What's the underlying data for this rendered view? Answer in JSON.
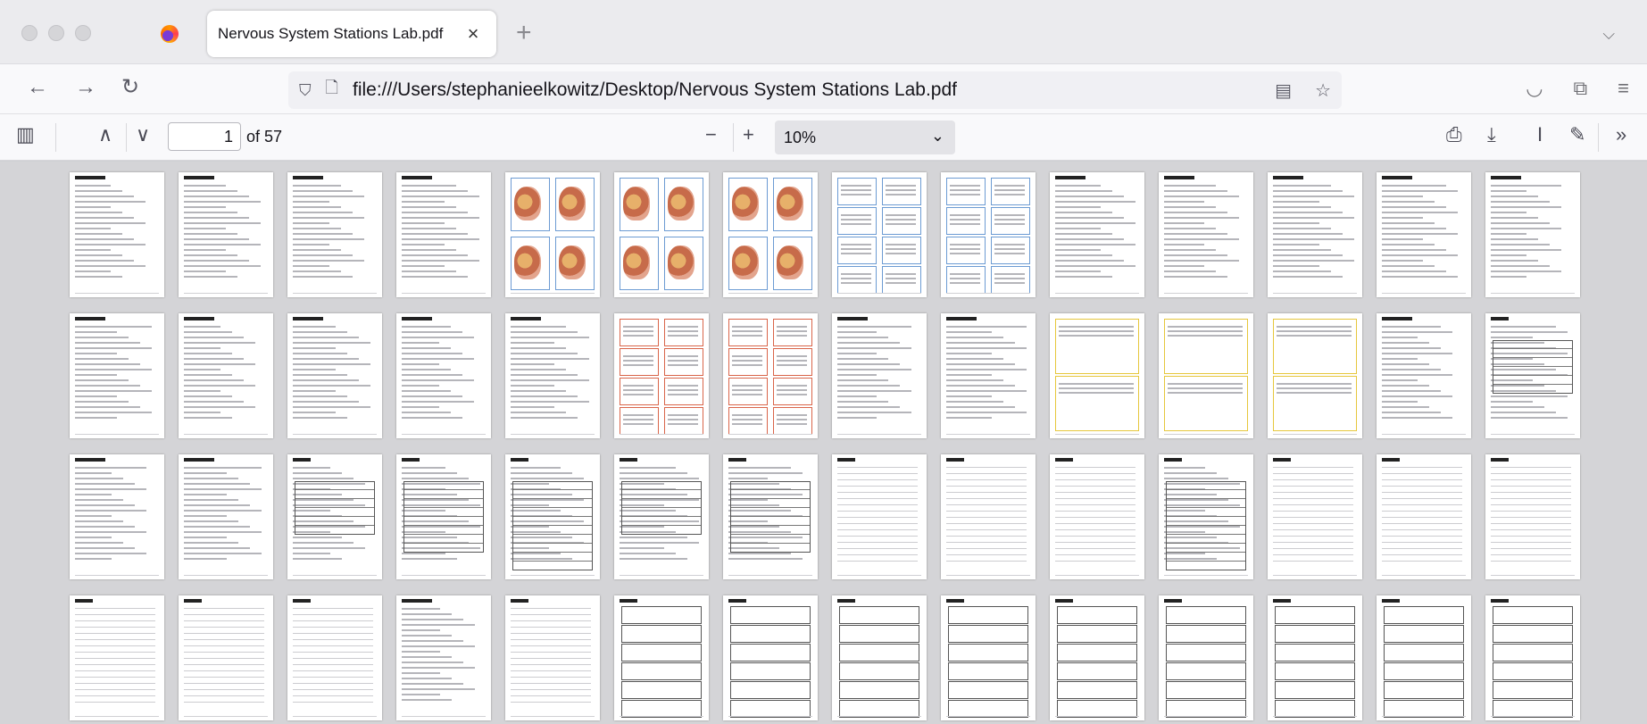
{
  "browser": {
    "tab_title": "Nervous System Stations Lab.pdf",
    "url": "file:///Users/stephanieelkowitz/Desktop/Nervous System Stations Lab.pdf"
  },
  "pdf": {
    "current_page": "1",
    "page_count_label": "of 57",
    "zoom": "10%",
    "thumbnail_count": 57
  },
  "icons": {
    "close": "×",
    "new_tab": "+",
    "tab_list": "⌵",
    "back": "←",
    "forward": "→",
    "reload": "↻",
    "shield": "⛉",
    "page": "🗋",
    "reader": "▤",
    "star": "☆",
    "pocket": "◡",
    "extensions": "⧉",
    "menu": "≡",
    "sidebar": "▥",
    "prev": "∧",
    "next": "∨",
    "zoom_out": "−",
    "zoom_in": "+",
    "chevron_down": "⌄",
    "print": "⎙",
    "save": "⤓",
    "text_cursor": "I",
    "draw": "✎",
    "more": "»"
  }
}
